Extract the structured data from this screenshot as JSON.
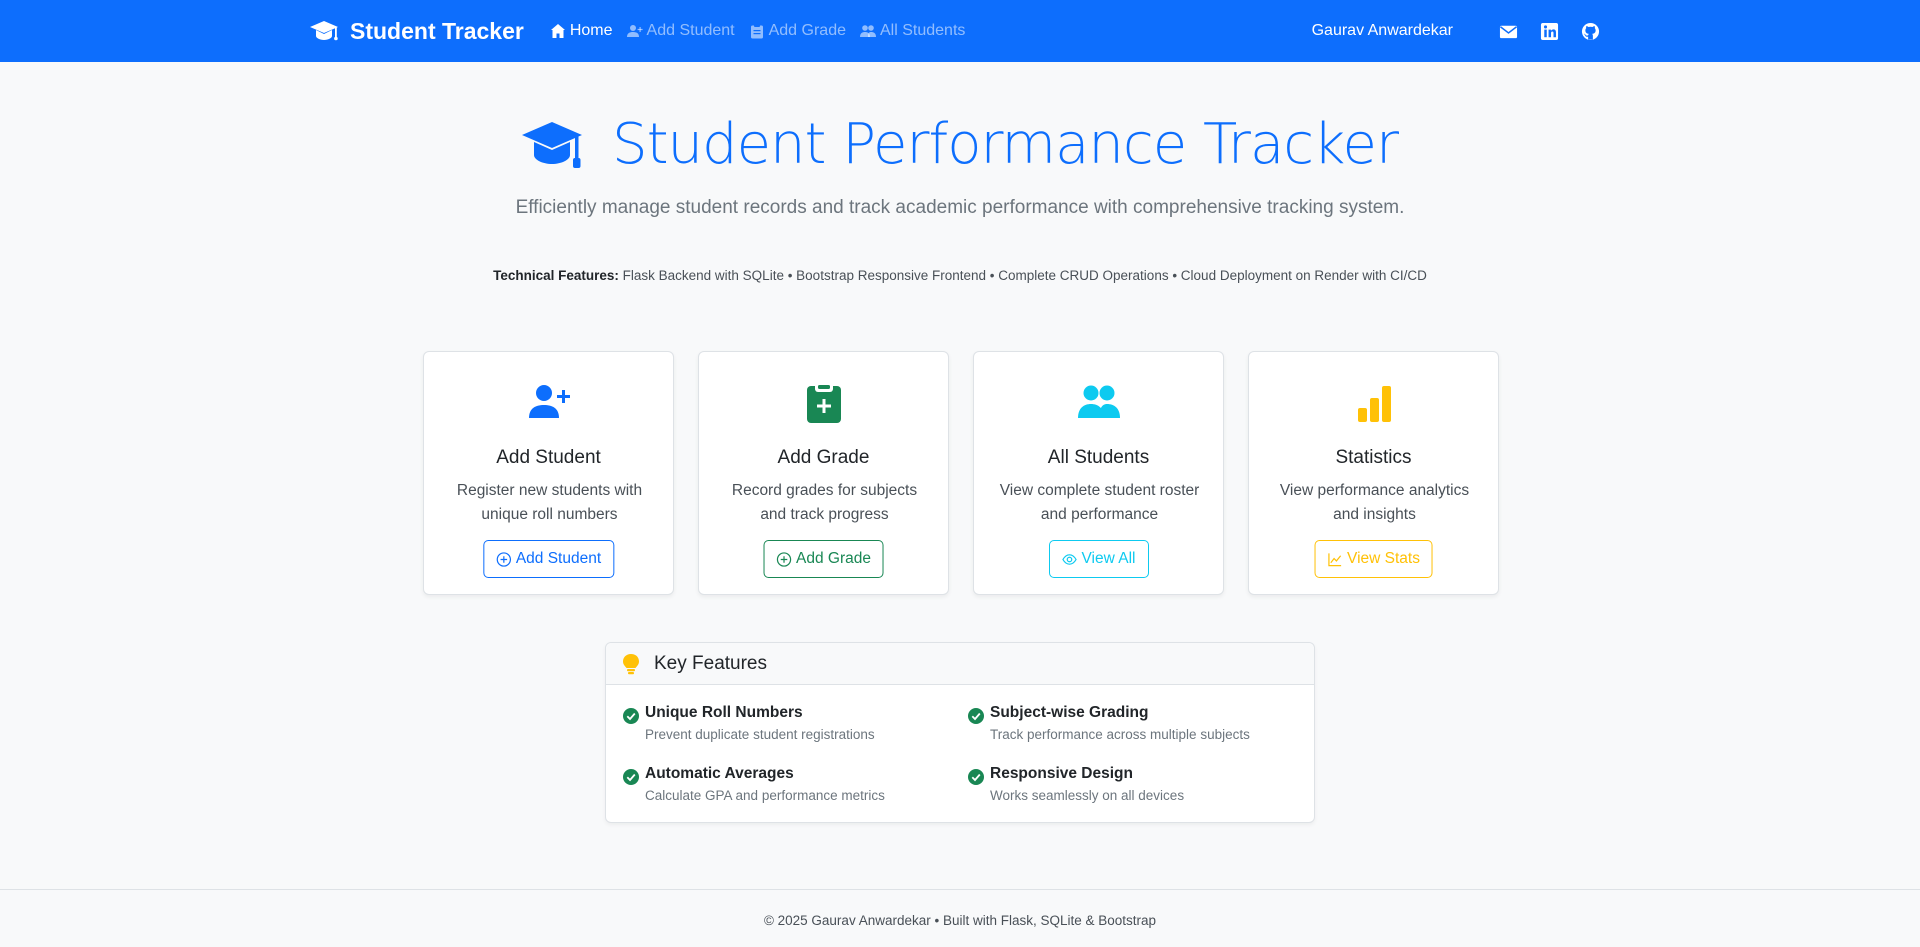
{
  "nav": {
    "brand": "Student Tracker",
    "links": [
      {
        "label": "Home",
        "icon": "house-icon"
      },
      {
        "label": "Add Student",
        "icon": "person-plus-icon"
      },
      {
        "label": "Add Grade",
        "icon": "clipboard-icon"
      },
      {
        "label": "All Students",
        "icon": "people-icon"
      }
    ],
    "user": "Gaurav Anwardekar",
    "social": [
      "envelope-icon",
      "linkedin-icon",
      "github-icon"
    ]
  },
  "hero": {
    "title": "Student Performance Tracker",
    "lead": "Efficiently manage student records and track academic performance with comprehensive tracking system.",
    "tech_label": "Technical Features:",
    "tech_text": " Flask Backend with SQLite • Bootstrap Responsive Frontend • Complete CRUD Operations • Cloud Deployment on Render with CI/CD"
  },
  "cards": [
    {
      "title": "Add Student",
      "desc": "Register new students with unique roll numbers",
      "button": "Add Student",
      "color": "#0d6efd"
    },
    {
      "title": "Add Grade",
      "desc": "Record grades for subjects and track progress",
      "button": "Add Grade",
      "color": "#198754"
    },
    {
      "title": "All Students",
      "desc": "View complete student roster and performance",
      "button": "View All",
      "color": "#0dcaf0"
    },
    {
      "title": "Statistics",
      "desc": "View performance analytics and insights",
      "button": "View Stats",
      "color": "#ffc107"
    }
  ],
  "features": {
    "title": "Key Features",
    "items": [
      {
        "title": "Unique Roll Numbers",
        "desc": "Prevent duplicate student registrations"
      },
      {
        "title": "Subject-wise Grading",
        "desc": "Track performance across multiple subjects"
      },
      {
        "title": "Automatic Averages",
        "desc": "Calculate GPA and performance metrics"
      },
      {
        "title": "Responsive Design",
        "desc": "Works seamlessly on all devices"
      }
    ]
  },
  "footer": "© 2025 Gaurav Anwardekar • Built with Flask, SQLite & Bootstrap",
  "colors": {
    "primary": "#0d6efd",
    "success": "#198754",
    "info": "#0dcaf0",
    "warning": "#ffc107"
  }
}
